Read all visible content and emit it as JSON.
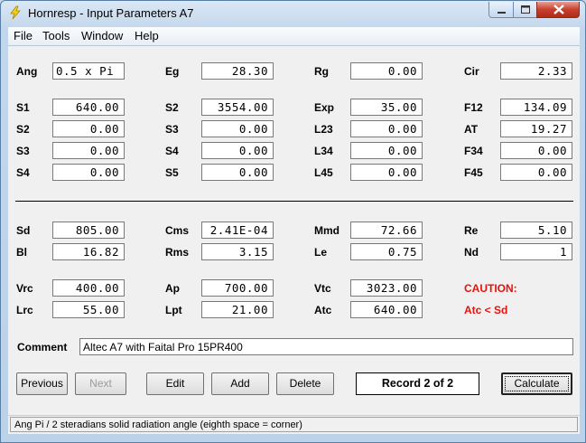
{
  "window": {
    "title": "Hornresp - Input Parameters   A7"
  },
  "menu": [
    "File",
    "Tools",
    "Window",
    "Help"
  ],
  "params": {
    "ang": {
      "label": "Ang",
      "value": "0.5 x Pi"
    },
    "eg": {
      "label": "Eg",
      "value": "28.30"
    },
    "rg": {
      "label": "Rg",
      "value": "0.00"
    },
    "cir": {
      "label": "Cir",
      "value": "2.33"
    },
    "s1": {
      "label": "S1",
      "value": "640.00"
    },
    "s2a": {
      "label": "S2",
      "value": "3554.00"
    },
    "exp": {
      "label": "Exp",
      "value": "35.00"
    },
    "f12": {
      "label": "F12",
      "value": "134.09"
    },
    "s2": {
      "label": "S2",
      "value": "0.00"
    },
    "s3a": {
      "label": "S3",
      "value": "0.00"
    },
    "l23": {
      "label": "L23",
      "value": "0.00"
    },
    "at": {
      "label": "AT",
      "value": "19.27"
    },
    "s3": {
      "label": "S3",
      "value": "0.00"
    },
    "s4a": {
      "label": "S4",
      "value": "0.00"
    },
    "l34": {
      "label": "L34",
      "value": "0.00"
    },
    "f34": {
      "label": "F34",
      "value": "0.00"
    },
    "s4": {
      "label": "S4",
      "value": "0.00"
    },
    "s5": {
      "label": "S5",
      "value": "0.00"
    },
    "l45": {
      "label": "L45",
      "value": "0.00"
    },
    "f45": {
      "label": "F45",
      "value": "0.00"
    },
    "sd": {
      "label": "Sd",
      "value": "805.00"
    },
    "cms": {
      "label": "Cms",
      "value": "2.41E-04"
    },
    "mmd": {
      "label": "Mmd",
      "value": "72.66"
    },
    "re": {
      "label": "Re",
      "value": "5.10"
    },
    "bl": {
      "label": "Bl",
      "value": "16.82"
    },
    "rms": {
      "label": "Rms",
      "value": "3.15"
    },
    "le": {
      "label": "Le",
      "value": "0.75"
    },
    "nd": {
      "label": "Nd",
      "value": "1"
    },
    "vrc": {
      "label": "Vrc",
      "value": "400.00"
    },
    "ap": {
      "label": "Ap",
      "value": "700.00"
    },
    "vtc": {
      "label": "Vtc",
      "value": "3023.00"
    },
    "lrc": {
      "label": "Lrc",
      "value": "55.00"
    },
    "lpt": {
      "label": "Lpt",
      "value": "21.00"
    },
    "atc": {
      "label": "Atc",
      "value": "640.00"
    }
  },
  "caution": {
    "title": "CAUTION:",
    "message": "Atc < Sd"
  },
  "comment": {
    "label": "Comment",
    "value": "Altec A7 with Faital Pro 15PR400"
  },
  "buttons": {
    "previous": "Previous",
    "next": "Next",
    "edit": "Edit",
    "add": "Add",
    "delete": "Delete",
    "calculate": "Calculate"
  },
  "record": "Record 2 of 2",
  "status": "Ang  Pi / 2 steradians solid radiation angle  (eighth space = corner)",
  "colors": {
    "caution": "#e8120c",
    "titlebar": "#c3d7ec",
    "close_button": "#c7402d"
  }
}
